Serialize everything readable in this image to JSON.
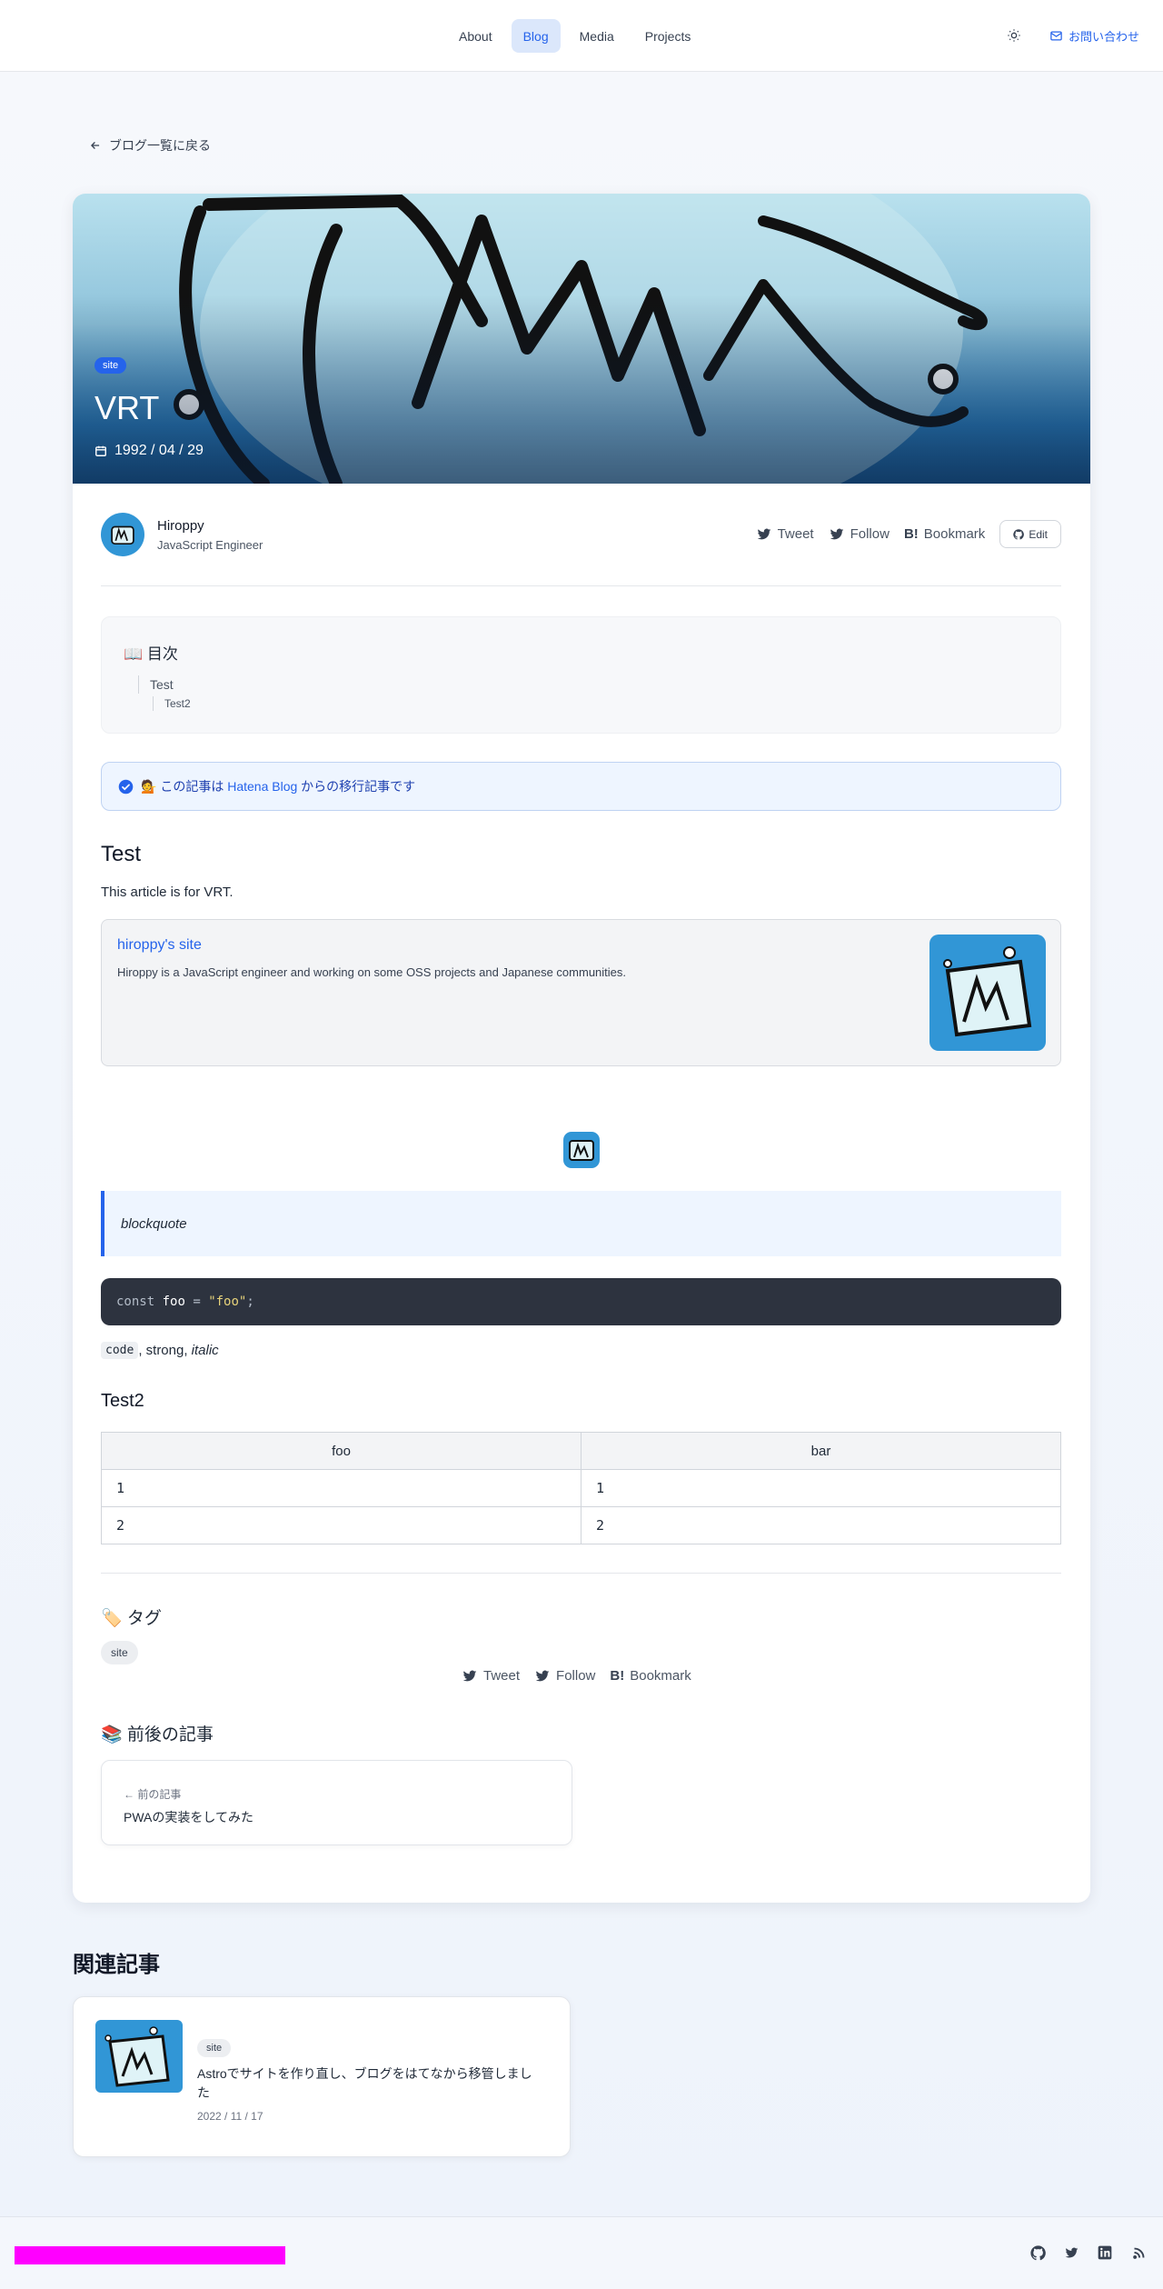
{
  "nav": {
    "items": [
      "About",
      "Blog",
      "Media",
      "Projects"
    ],
    "active": "Blog"
  },
  "header": {
    "contact_label": "お問い合わせ"
  },
  "back_link": "ブログ一覧に戻る",
  "hero": {
    "tag": "site",
    "title": "VRT",
    "date": "1992 / 04 / 29"
  },
  "author": {
    "name": "Hiroppy",
    "role": "JavaScript Engineer"
  },
  "share": {
    "tweet": "Tweet",
    "follow": "Follow",
    "bookmark": "Bookmark",
    "edit": "Edit"
  },
  "toc": {
    "title": "📖 目次",
    "items": [
      {
        "label": "Test",
        "level": 1
      },
      {
        "label": "Test2",
        "level": 2
      }
    ]
  },
  "notice": {
    "prefix": "💁 この記事は ",
    "link": "Hatena Blog",
    "suffix": " からの移行記事です"
  },
  "article": {
    "h2_test": "Test",
    "paragraph": "This article is for VRT.",
    "link_card": {
      "title": "hiroppy's site",
      "description": "Hiroppy is a JavaScript engineer and working on some OSS projects and Japanese communities."
    },
    "blockquote": "blockquote",
    "code": {
      "kw": "const",
      "id": "foo",
      "op": "=",
      "str": "\"foo\"",
      "end": ";"
    },
    "inline": {
      "code": "code",
      "rest1": ", strong, ",
      "italic": "italic"
    },
    "h2_test2": "Test2",
    "table": {
      "headers": [
        "foo",
        "bar"
      ],
      "rows": [
        [
          "1",
          "1"
        ],
        [
          "2",
          "2"
        ]
      ]
    }
  },
  "tags": {
    "title": "🏷️ タグ",
    "items": [
      "site"
    ]
  },
  "prev_next": {
    "title": "📚 前後の記事",
    "prev_label": "← 前の記事",
    "prev_title": "PWAの実装をしてみた"
  },
  "related": {
    "title": "関連記事",
    "items": [
      {
        "tag": "site",
        "title": "Astroでサイトを作り直し、ブログをはてなから移管しました",
        "date": "2022 / 11 / 17"
      }
    ]
  },
  "footer": {
    "icons": [
      "github-icon",
      "twitter-icon",
      "linkedin-icon",
      "rss-icon"
    ]
  },
  "colors": {
    "accent": "#2563eb",
    "hero_blue": "#3196d6",
    "footer_bar": "#ff00ff"
  }
}
